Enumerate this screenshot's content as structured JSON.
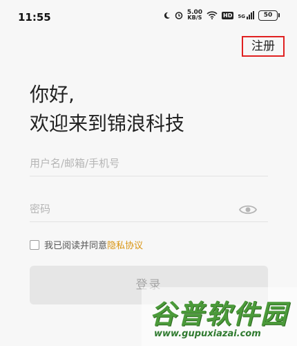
{
  "status_bar": {
    "time": "11:55",
    "net_speed_value": "5.00",
    "net_speed_unit": "KB/S",
    "hd_label": "HD",
    "signal_label": "5G",
    "battery": "50"
  },
  "header": {
    "register_label": "注册"
  },
  "greeting": {
    "line1": "你好,",
    "line2": "欢迎来到锦浪科技"
  },
  "form": {
    "username_placeholder": "用户名/邮箱/手机号",
    "password_placeholder": "密码",
    "agree_text": "我已阅读并同意 ",
    "privacy_link": "隐私协议",
    "login_label": "登录"
  },
  "watermark": {
    "title": "谷普软件园",
    "url": "www.gupuxiazai.com"
  },
  "colors": {
    "register_border": "#e02020",
    "privacy_link": "#d99411",
    "watermark_green": "#4b9a3a"
  }
}
